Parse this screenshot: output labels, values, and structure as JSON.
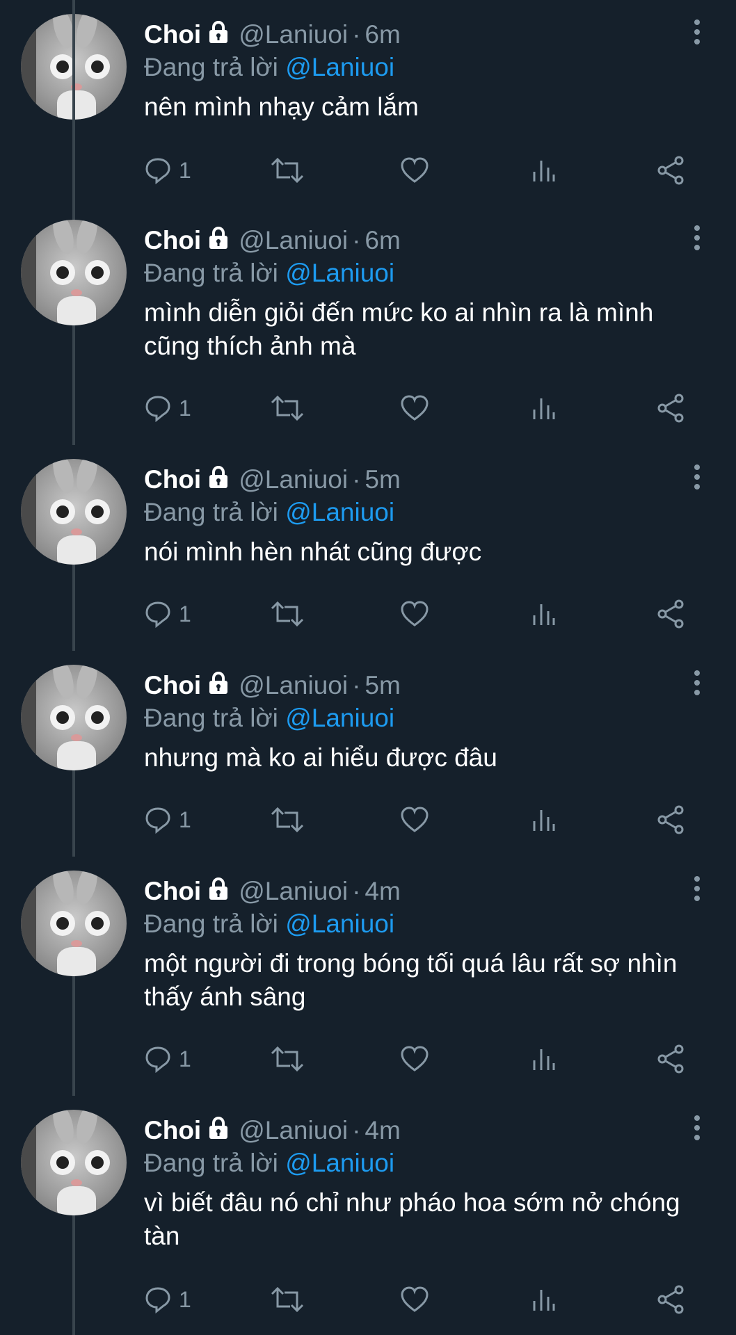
{
  "tweets": [
    {
      "name": "Choi",
      "handle": "@Laniuoi",
      "sep": "·",
      "time": "6m",
      "reply_prefix": "Đang trả lời",
      "reply_to": "@Laniuoi",
      "text": "nên mình nhạy cảm lắm",
      "reply_count": "1"
    },
    {
      "name": "Choi",
      "handle": "@Laniuoi",
      "sep": "·",
      "time": "6m",
      "reply_prefix": "Đang trả lời",
      "reply_to": "@Laniuoi",
      "text": "mình diễn giỏi đến mức ko ai nhìn ra là mình cũng thích ảnh mà",
      "reply_count": "1"
    },
    {
      "name": "Choi",
      "handle": "@Laniuoi",
      "sep": "·",
      "time": "5m",
      "reply_prefix": "Đang trả lời",
      "reply_to": "@Laniuoi",
      "text": "nói mình hèn nhát cũng được",
      "reply_count": "1"
    },
    {
      "name": "Choi",
      "handle": "@Laniuoi",
      "sep": "·",
      "time": "5m",
      "reply_prefix": "Đang trả lời",
      "reply_to": "@Laniuoi",
      "text": "nhưng mà ko ai hiểu được đâu",
      "reply_count": "1"
    },
    {
      "name": "Choi",
      "handle": "@Laniuoi",
      "sep": "·",
      "time": "4m",
      "reply_prefix": "Đang trả lời",
      "reply_to": "@Laniuoi",
      "text": "một người đi trong bóng tối quá lâu rất sợ nhìn thấy ánh sâng",
      "reply_count": "1"
    },
    {
      "name": "Choi",
      "handle": "@Laniuoi",
      "sep": "·",
      "time": "4m",
      "reply_prefix": "Đang trả lời",
      "reply_to": "@Laniuoi",
      "text": "vì biết đâu nó chỉ như pháo hoa sớm nở chóng tàn",
      "reply_count": "1"
    }
  ],
  "icons": {
    "lock": "lock-icon",
    "more": "more-vertical-icon",
    "reply": "reply-icon",
    "retweet": "retweet-icon",
    "like": "heart-icon",
    "views": "analytics-icon",
    "share": "share-icon"
  },
  "colors": {
    "background": "#15202b",
    "text": "#ffffff",
    "muted": "#8899a6",
    "mention": "#1d9bf0",
    "thread_line": "#38444d"
  }
}
